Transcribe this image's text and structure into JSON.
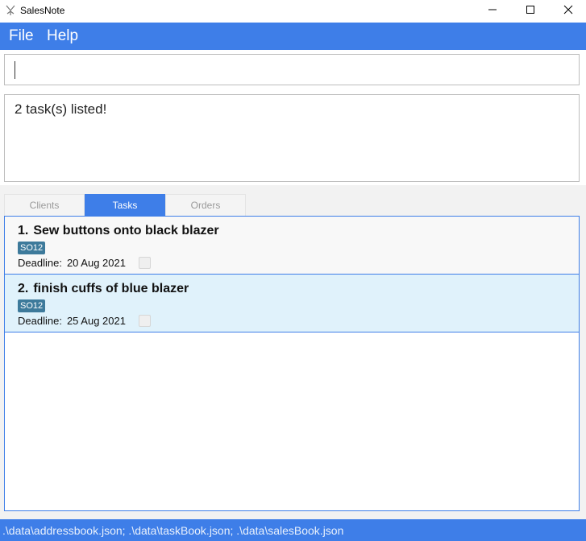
{
  "window": {
    "title": "SalesNote"
  },
  "menu": {
    "items": [
      "File",
      "Help"
    ]
  },
  "command": {
    "value": "",
    "placeholder": ""
  },
  "result": {
    "message": "2 task(s) listed!"
  },
  "tabs": [
    {
      "label": "Clients",
      "active": false
    },
    {
      "label": "Tasks",
      "active": true
    },
    {
      "label": "Orders",
      "active": false
    }
  ],
  "tasks": [
    {
      "index": "1.",
      "title": "Sew buttons onto black blazer",
      "tag": "SO12",
      "deadline_label": "Deadline:",
      "deadline": "20 Aug 2021",
      "done": false
    },
    {
      "index": "2.",
      "title": "finish cuffs of blue blazer",
      "tag": "SO12",
      "deadline_label": "Deadline:",
      "deadline": "25 Aug 2021",
      "done": false
    }
  ],
  "status": {
    "text": ".\\data\\addressbook.json; .\\data\\taskBook.json; .\\data\\salesBook.json"
  },
  "colors": {
    "accent": "#3e7ee8",
    "tag": "#3d7a9b",
    "selected_row": "#e0f2fb"
  },
  "icons": {
    "app": "app-icon",
    "minimize": "minimize-icon",
    "maximize": "maximize-icon",
    "close": "close-icon"
  }
}
